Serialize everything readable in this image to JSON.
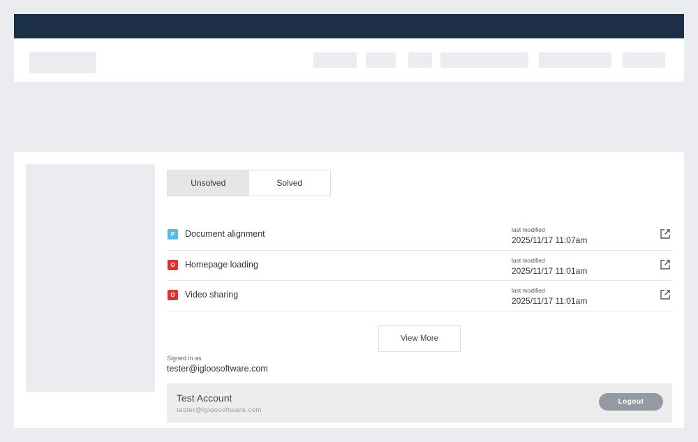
{
  "tabs": [
    {
      "label": "Unsolved",
      "active": true
    },
    {
      "label": "Solved",
      "active": false
    }
  ],
  "items": [
    {
      "badge": "P",
      "badge_color": "#5bb8e0",
      "title": "Document alignment",
      "meta_label": "last modified",
      "modified": "2025/11/17  11:07am"
    },
    {
      "badge": "O",
      "badge_color": "#e03030",
      "title": "Homepage loading",
      "meta_label": "last modified",
      "modified": "2025/11/17  11:01am"
    },
    {
      "badge": "O",
      "badge_color": "#e03030",
      "title": "Video sharing",
      "meta_label": "last modified",
      "modified": "2025/11/17  11:01am"
    }
  ],
  "view_more_label": "View More",
  "signed_in": {
    "label": "Signed in as",
    "email": "tester@igloosoftware.com"
  },
  "account": {
    "name": "Test Account",
    "email": "tester@igloosoftware.com",
    "logout_label": "Logout"
  },
  "colors": {
    "topbar": "#1b3046",
    "placeholder": "#ebecf0",
    "logout": "#949aa3"
  },
  "icons": {
    "open": "external-link-icon"
  }
}
